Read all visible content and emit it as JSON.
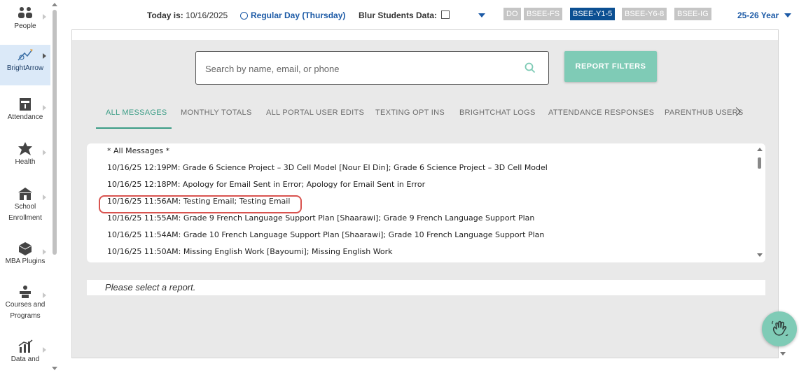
{
  "sidebar": {
    "items": [
      {
        "label": "People",
        "icon": "people-icon"
      },
      {
        "label": "BrightArrow",
        "icon": "brightarrow-icon",
        "active": true
      },
      {
        "label": "Attendance",
        "icon": "attendance-icon"
      },
      {
        "label": "Health",
        "icon": "health-icon"
      },
      {
        "label": "School Enrollment",
        "icon": "school-icon"
      },
      {
        "label": "MBA Plugins",
        "icon": "plugin-icon"
      },
      {
        "label": "Courses and Programs",
        "icon": "courses-icon"
      },
      {
        "label": "Data and",
        "icon": "data-icon"
      }
    ]
  },
  "topbar": {
    "today_label": "Today is:",
    "today_date": "10/16/2025",
    "day_type": "Regular Day (Thursday)",
    "blur_label": "Blur Students Data:",
    "tags": [
      "DO",
      "BSEE-FS",
      "BSEE-Y1-5",
      "BSEE-Y6-8",
      "BSEE-IG"
    ],
    "active_tag": "BSEE-Y1-5",
    "year": "25-26 Year"
  },
  "search": {
    "placeholder": "Search by name, email, or phone"
  },
  "filters_button": "REPORT FILTERS",
  "tabs": [
    "ALL MESSAGES",
    "MONTHLY TOTALS",
    "ALL PORTAL USER EDITS",
    "TEXTING OPT INS",
    "BRIGHTCHAT LOGS",
    "ATTENDANCE RESPONSES",
    "PARENTHUB USERS"
  ],
  "active_tab": "ALL MESSAGES",
  "messages": [
    "* All Messages *",
    "10/16/25 12:19PM: Grade 6 Science Project – 3D Cell Model [Nour El Din]; Grade 6 Science Project – 3D Cell Model",
    "10/16/25 12:18PM: Apology for Email Sent in Error; Apology for Email Sent in Error",
    "10/16/25 11:56AM: Testing Email; Testing Email",
    "10/16/25 11:55AM: Grade 9 French Language Support Plan [Shaarawi]; Grade 9 French Language Support Plan",
    "10/16/25 11:54AM: Grade 10 French Language Support Plan [Shaarawi]; Grade 10 French Language Support Plan",
    "10/16/25 11:50AM: Missing English Work [Bayoumi]; Missing English Work"
  ],
  "highlighted_message_index": 3,
  "report_placeholder": "Please select a report.",
  "colors": {
    "accent": "#7fcbb6",
    "tab_active": "#3c9d86",
    "link_blue": "#1c5aa6",
    "tag_active": "#0b4f92",
    "tag_inactive": "#c5c5c5",
    "highlight": "#d9534f"
  }
}
